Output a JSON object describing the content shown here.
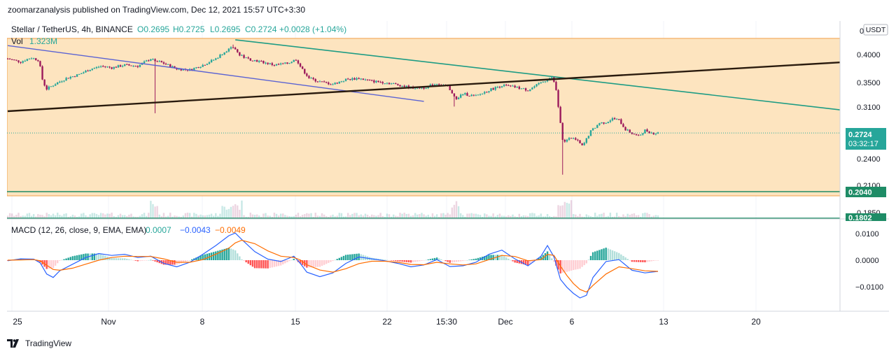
{
  "header": {
    "publisher_line": "zoomarzanalysis published on TradingView.com, Dec 12, 2021 15:57 UTC+3:30"
  },
  "legend": {
    "symbol": "Stellar / TetherUS, 4h, BINANCE",
    "o": "O0.2695",
    "h": "H0.2725",
    "l": "L0.2695",
    "c": "C0.2724",
    "change": "+0.0028 (+1.04%)",
    "vol_label": "Vol",
    "vol_value": "1.323M",
    "macd_label": "MACD (12, 26, close, 9, EMA, EMA)",
    "macd_v1": "0.0007",
    "macd_v2": "−0.0043",
    "macd_v3": "−0.0049"
  },
  "price_axis": {
    "currency": "USDT",
    "partial_top": "0",
    "ticks": [
      "0.4000",
      "0.3500",
      "0.3100",
      "0.2400",
      "0.2100",
      "0.1850"
    ],
    "last_price": "0.2724",
    "countdown": "03:32:17",
    "level1": "0.2040",
    "level2": "0.1802"
  },
  "macd_axis": {
    "ticks": [
      "0.0100",
      "0.0000",
      "−0.0100"
    ]
  },
  "time_axis": {
    "ticks": [
      "25",
      "Nov",
      "8",
      "15",
      "22",
      "15:30",
      "Dec",
      "6",
      "13",
      "20"
    ]
  },
  "footer": {
    "brand": "TradingView"
  },
  "colors": {
    "zone_fill": "#fde4bf",
    "zone_border": "#f0a04b",
    "up": "#26a69a",
    "down": "#9c1a5c",
    "trend_teal": "#1e9c84",
    "trend_blue": "#5b63d3",
    "trend_black": "#2a1b0e",
    "level_green": "#1e8c66",
    "macd_line": "#2962ff",
    "signal_line": "#ff6d00"
  },
  "chart_data": {
    "type": "candlestick",
    "title": "Stellar / TetherUS, 4h, BINANCE",
    "yscale": "log",
    "ylim": [
      0.18,
      0.43
    ],
    "x_range_days": [
      -7,
      43
    ],
    "x_origin": "2021-10-25",
    "close_path": [
      [
        -7,
        0.392
      ],
      [
        -6,
        0.386
      ],
      [
        -5.2,
        0.394
      ],
      [
        -4.6,
        0.389
      ],
      [
        -4.3,
        0.35
      ],
      [
        -4.0,
        0.338
      ],
      [
        -3.3,
        0.347
      ],
      [
        -2.5,
        0.356
      ],
      [
        -1.5,
        0.363
      ],
      [
        -0.7,
        0.372
      ],
      [
        0.2,
        0.378
      ],
      [
        1.0,
        0.375
      ],
      [
        2.0,
        0.38
      ],
      [
        3.0,
        0.378
      ],
      [
        4.0,
        0.392
      ],
      [
        5.0,
        0.383
      ],
      [
        6.0,
        0.373
      ],
      [
        7.0,
        0.371
      ],
      [
        8.0,
        0.38
      ],
      [
        9.0,
        0.392
      ],
      [
        9.8,
        0.408
      ],
      [
        10.4,
        0.415
      ],
      [
        10.8,
        0.399
      ],
      [
        11.4,
        0.392
      ],
      [
        12.5,
        0.386
      ],
      [
        13.5,
        0.38
      ],
      [
        14.5,
        0.383
      ],
      [
        15.2,
        0.391
      ],
      [
        15.6,
        0.373
      ],
      [
        16.2,
        0.356
      ],
      [
        17.0,
        0.35
      ],
      [
        18.0,
        0.346
      ],
      [
        19.0,
        0.354
      ],
      [
        20.0,
        0.356
      ],
      [
        21.0,
        0.351
      ],
      [
        22.0,
        0.349
      ],
      [
        23.0,
        0.345
      ],
      [
        24.0,
        0.34
      ],
      [
        25.0,
        0.34
      ],
      [
        26.0,
        0.347
      ],
      [
        26.8,
        0.342
      ],
      [
        27.4,
        0.322
      ],
      [
        28.0,
        0.33
      ],
      [
        29.0,
        0.326
      ],
      [
        30.0,
        0.336
      ],
      [
        31.0,
        0.344
      ],
      [
        32.0,
        0.341
      ],
      [
        33.0,
        0.336
      ],
      [
        34.0,
        0.348
      ],
      [
        34.8,
        0.358
      ],
      [
        35.1,
        0.346
      ],
      [
        35.4,
        0.3
      ],
      [
        35.7,
        0.258
      ],
      [
        36.2,
        0.268
      ],
      [
        36.8,
        0.262
      ],
      [
        37.2,
        0.255
      ],
      [
        37.8,
        0.274
      ],
      [
        38.5,
        0.286
      ],
      [
        39.0,
        0.287
      ],
      [
        39.5,
        0.292
      ],
      [
        40.0,
        0.29
      ],
      [
        40.5,
        0.277
      ],
      [
        41.0,
        0.272
      ],
      [
        41.5,
        0.268
      ],
      [
        42.0,
        0.276
      ],
      [
        42.6,
        0.272
      ],
      [
        43.0,
        0.2724
      ]
    ],
    "drawings": [
      {
        "name": "upper-descending-trendline",
        "from": [
          10.5,
          0.43
        ],
        "to": [
          73,
          0.305
        ]
      },
      {
        "name": "left-descending-trendline",
        "from": [
          -7,
          0.418
        ],
        "to": [
          25,
          0.318
        ]
      },
      {
        "name": "ascending-trendline",
        "from": [
          -7,
          0.303
        ],
        "to": [
          73,
          0.385
        ]
      },
      {
        "name": "resistance-zone-top",
        "value": 0.433
      },
      {
        "name": "support-level",
        "value": 0.204
      },
      {
        "name": "support-level",
        "value": 0.1802
      }
    ],
    "macd": {
      "x": [
        -7,
        -6,
        -5,
        -4.5,
        -4,
        -3.5,
        -3,
        -2,
        -1,
        0,
        1,
        2,
        3,
        4,
        5,
        6,
        7,
        8,
        9,
        10,
        10.5,
        11,
        12,
        13,
        14,
        15,
        15.5,
        16,
        17,
        18,
        19,
        20,
        21,
        22,
        23,
        24,
        25,
        26,
        27,
        28,
        29,
        30,
        31,
        32,
        33,
        34,
        34.5,
        35,
        35.5,
        36,
        36.5,
        37,
        37.5,
        38,
        39,
        40,
        41,
        42,
        43
      ],
      "macd": [
        -0.0002,
        0.0005,
        0.0004,
        -0.001,
        -0.0052,
        -0.0065,
        -0.004,
        -0.0015,
        0.001,
        0.0025,
        0.0018,
        0.0022,
        0.001,
        0.0015,
        -0.0012,
        -0.0025,
        -0.0008,
        0.0022,
        0.0055,
        0.0092,
        0.0102,
        0.0078,
        0.0032,
        0.0004,
        -0.0005,
        0.0015,
        -0.0012,
        -0.0045,
        -0.0062,
        -0.0048,
        -0.0012,
        0.0012,
        0.0005,
        -0.0002,
        -0.0012,
        -0.0025,
        -0.0018,
        0.0002,
        -0.0024,
        -0.0021,
        -0.0008,
        0.0022,
        0.0038,
        0.0005,
        -0.0021,
        0.0015,
        0.0055,
        0.0012,
        -0.0072,
        -0.0102,
        -0.0125,
        -0.0142,
        -0.0132,
        -0.0065,
        -0.0005,
        0.0002,
        -0.0038,
        -0.0048,
        -0.0042
      ],
      "signal": [
        0.0,
        0.0001,
        0.0002,
        -0.0002,
        -0.0019,
        -0.0035,
        -0.0038,
        -0.003,
        -0.0015,
        0.0,
        0.001,
        0.0015,
        0.0014,
        0.0014,
        0.0005,
        -0.0008,
        -0.0008,
        0.0002,
        0.0022,
        0.0045,
        0.0065,
        0.0075,
        0.0062,
        0.0035,
        0.0015,
        0.001,
        0.0001,
        -0.0017,
        -0.0037,
        -0.0045,
        -0.0032,
        -0.0013,
        -0.0004,
        -0.0004,
        -0.0008,
        -0.0016,
        -0.0017,
        -0.0008,
        -0.0014,
        -0.0018,
        -0.0014,
        0.0002,
        0.0018,
        0.0014,
        -0.0002,
        0.0002,
        0.0022,
        0.0018,
        -0.0022,
        -0.0058,
        -0.0088,
        -0.011,
        -0.012,
        -0.0095,
        -0.0052,
        -0.0025,
        -0.0032,
        -0.004,
        -0.0042
      ]
    }
  }
}
